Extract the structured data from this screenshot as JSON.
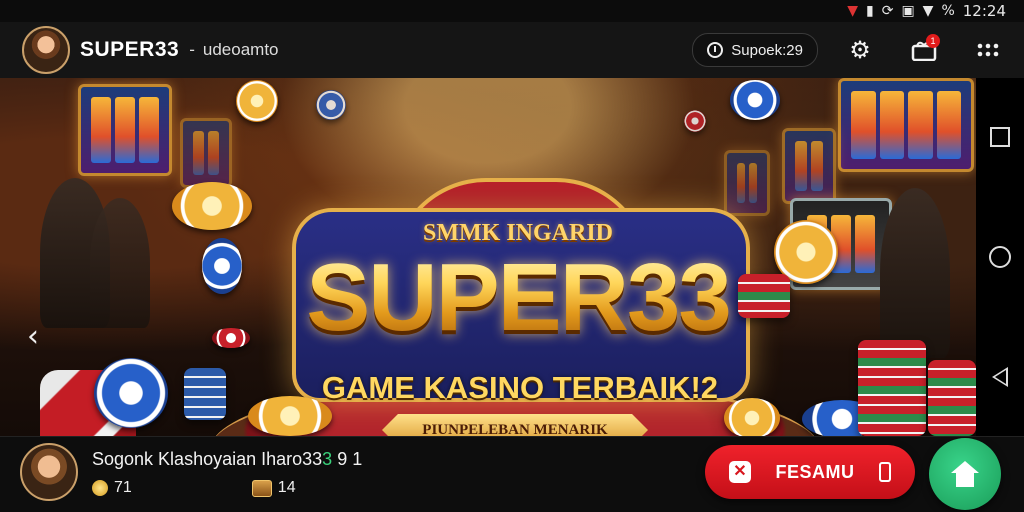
{
  "status_bar": {
    "time": "12:24",
    "icons": [
      "signal-icon",
      "wifi-icon",
      "sync-icon",
      "screenshot-icon",
      "wifi-icon",
      "battery-icon"
    ]
  },
  "topbar": {
    "title": "SUPER33",
    "separator": "-",
    "subtitle": "udeoamto",
    "timer_chip": "Supoek:29",
    "badge_count": "1",
    "icons": [
      "clock-icon",
      "gear-icon",
      "gift-box-icon",
      "grid-menu-icon"
    ]
  },
  "banner": {
    "logo_top": "SMMK INGARID",
    "logo_main": "SUPER33",
    "logo_sub": "GAME KASINO TERBAIK!2",
    "ribbon": "PIUNPELEBAN MENARIK",
    "nav_prev_glyph": "‹"
  },
  "bottombar": {
    "name": "Sogonk Klashoyaian Iharo33",
    "name_highlight": "3",
    "name_tail": "9 1",
    "stat_coins": "71",
    "stat_chest": "14",
    "cta_label": "FESAMU",
    "cta_icon_glyph": "✕"
  },
  "colors": {
    "accent_red": "#e21b1b",
    "accent_green": "#1fb76a",
    "gold": "#ffcf4a"
  }
}
